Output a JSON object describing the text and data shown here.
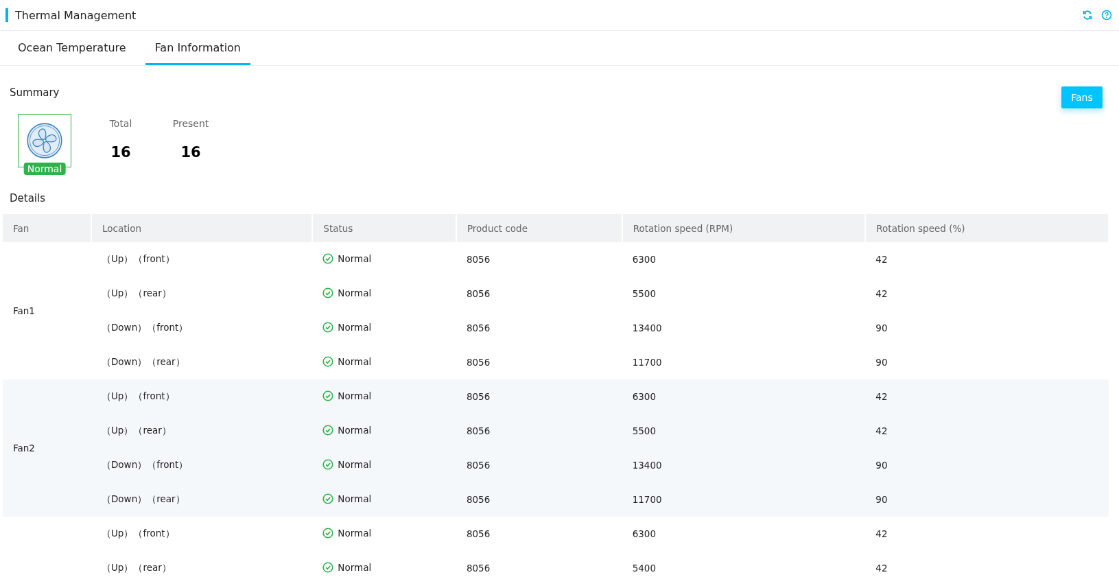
{
  "header": {
    "title": "Thermal Management"
  },
  "tabs": [
    {
      "label": "Ocean Temperature",
      "selected": false
    },
    {
      "label": "Fan Information",
      "selected": true
    }
  ],
  "summary": {
    "title": "Summary",
    "status": "Normal",
    "stats": [
      {
        "label": "Total",
        "value": "16"
      },
      {
        "label": "Present",
        "value": "16"
      }
    ],
    "button": "Fans"
  },
  "details": {
    "title": "Details",
    "columns": [
      "Fan",
      "Location",
      "Status",
      "Product code",
      "Rotation speed (RPM)",
      "Rotation speed (%)"
    ],
    "groups": [
      {
        "fan": "Fan1",
        "rows": [
          {
            "location": "（Up）（front）",
            "status": {
              "kind": "ok",
              "text": "Normal"
            },
            "product_code": "8056",
            "rpm": "6300",
            "percent": "42"
          },
          {
            "location": "（Up）（rear）",
            "status": {
              "kind": "ok",
              "text": "Normal"
            },
            "product_code": "8056",
            "rpm": "5500",
            "percent": "42"
          },
          {
            "location": "（Down）（front）",
            "status": {
              "kind": "ok",
              "text": "Normal"
            },
            "product_code": "8056",
            "rpm": "13400",
            "percent": "90"
          },
          {
            "location": "（Down）（rear）",
            "status": {
              "kind": "ok",
              "text": "Normal"
            },
            "product_code": "8056",
            "rpm": "11700",
            "percent": "90"
          }
        ]
      },
      {
        "fan": "Fan2",
        "rows": [
          {
            "location": "（Up）（front）",
            "status": {
              "kind": "ok",
              "text": "Normal"
            },
            "product_code": "8056",
            "rpm": "6300",
            "percent": "42"
          },
          {
            "location": "（Up）（rear）",
            "status": {
              "kind": "ok",
              "text": "Normal"
            },
            "product_code": "8056",
            "rpm": "5500",
            "percent": "42"
          },
          {
            "location": "（Down）（front）",
            "status": {
              "kind": "ok",
              "text": "Normal"
            },
            "product_code": "8056",
            "rpm": "13400",
            "percent": "90"
          },
          {
            "location": "（Down）（rear）",
            "status": {
              "kind": "ok",
              "text": "Normal"
            },
            "product_code": "8056",
            "rpm": "11700",
            "percent": "90"
          }
        ]
      },
      {
        "rows": [
          {
            "location": "（Up）（front）",
            "status": {
              "kind": "ok",
              "text": "Normal"
            },
            "product_code": "8056",
            "rpm": "6300",
            "percent": "42"
          },
          {
            "location": "（Up）（rear）",
            "status": {
              "kind": "ok",
              "text": "Normal"
            },
            "product_code": "8056",
            "rpm": "5400",
            "percent": "42"
          }
        ]
      }
    ]
  }
}
